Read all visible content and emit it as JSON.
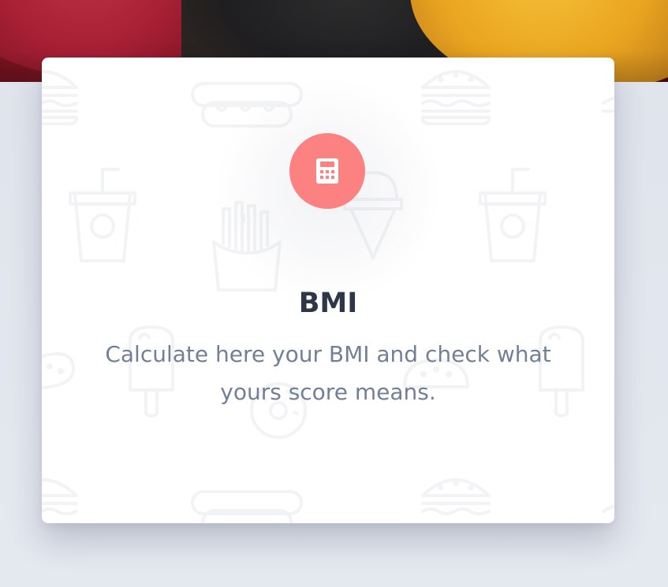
{
  "card": {
    "title": "BMI",
    "description": "Calculate here your BMI and check what yours score means.",
    "icon": "calculator-icon"
  },
  "colors": {
    "icon_background": "#fc8181",
    "title": "#2d3748",
    "description": "#718096",
    "page_background": "#e3e7ef",
    "card_background": "#ffffff"
  },
  "background_pattern_icons": [
    "burger-icon",
    "hotdog-icon",
    "soda-cup-icon",
    "fries-icon",
    "ice-cream-cone-icon",
    "popsicle-icon",
    "donut-icon",
    "taco-icon"
  ]
}
